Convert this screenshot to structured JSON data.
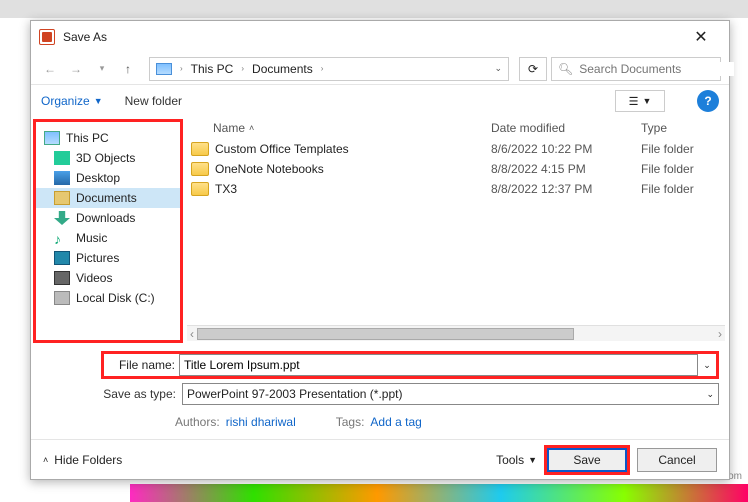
{
  "dialog": {
    "title": "Save As"
  },
  "nav": {
    "breadcrumbs": [
      "This PC",
      "Documents"
    ],
    "search_placeholder": "Search Documents"
  },
  "toolbar": {
    "organize": "Organize",
    "newfolder": "New folder"
  },
  "sidebar": {
    "items": [
      {
        "label": "This PC",
        "icon": "pc"
      },
      {
        "label": "3D Objects",
        "icon": "3d"
      },
      {
        "label": "Desktop",
        "icon": "desktop"
      },
      {
        "label": "Documents",
        "icon": "docs",
        "selected": true
      },
      {
        "label": "Downloads",
        "icon": "dl"
      },
      {
        "label": "Music",
        "icon": "music"
      },
      {
        "label": "Pictures",
        "icon": "pic"
      },
      {
        "label": "Videos",
        "icon": "vid"
      },
      {
        "label": "Local Disk (C:)",
        "icon": "disk"
      }
    ]
  },
  "columns": {
    "name": "Name",
    "date": "Date modified",
    "type": "Type"
  },
  "files": [
    {
      "name": "Custom Office Templates",
      "date": "8/6/2022 10:22 PM",
      "type": "File folder"
    },
    {
      "name": "OneNote Notebooks",
      "date": "8/8/2022 4:15 PM",
      "type": "File folder"
    },
    {
      "name": "TX3",
      "date": "8/8/2022 12:37 PM",
      "type": "File folder"
    }
  ],
  "form": {
    "filename_label": "File name:",
    "filename_value": "Title Lorem Ipsum.ppt",
    "type_label": "Save as type:",
    "type_value": "PowerPoint 97-2003 Presentation (*.ppt)",
    "authors_label": "Authors:",
    "authors_value": "rishi dhariwal",
    "tags_label": "Tags:",
    "tags_value": "Add a tag"
  },
  "footer": {
    "hide": "Hide Folders",
    "tools": "Tools",
    "save": "Save",
    "cancel": "Cancel"
  },
  "watermark": "wsxdn.com"
}
